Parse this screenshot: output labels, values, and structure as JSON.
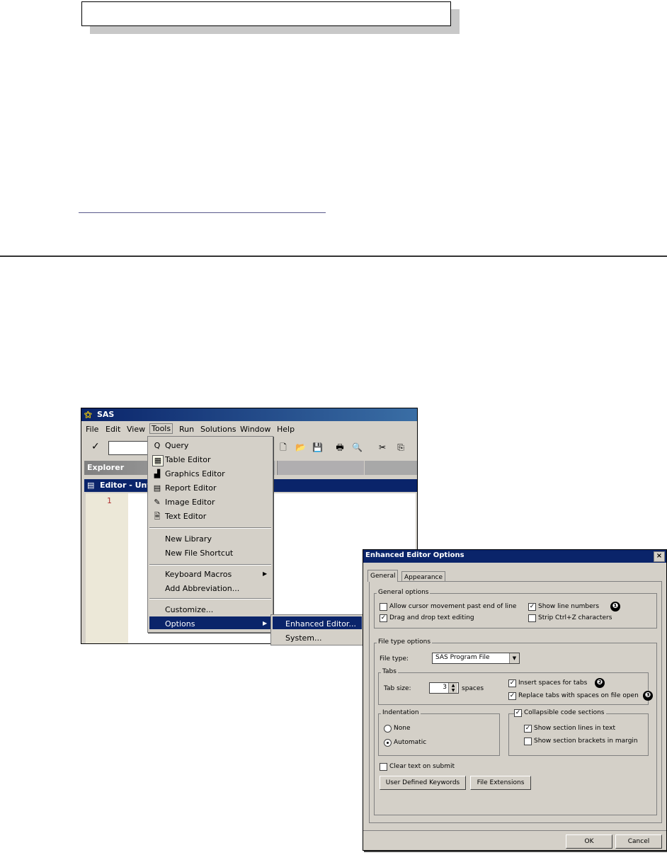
{
  "sas_window": {
    "title": "SAS",
    "menus": [
      "File",
      "Edit",
      "View",
      "Tools",
      "Run",
      "Solutions",
      "Window",
      "Help"
    ],
    "explorer_label": "Explorer",
    "editor_title": "Editor - Unti",
    "line_number": "1"
  },
  "tools_menu": {
    "items": [
      {
        "label": "Query",
        "icon": "query-icon"
      },
      {
        "label": "Table Editor",
        "icon": "table-editor-icon"
      },
      {
        "label": "Graphics Editor",
        "icon": "graphics-editor-icon"
      },
      {
        "label": "Report Editor",
        "icon": "report-editor-icon"
      },
      {
        "label": "Image Editor",
        "icon": "image-editor-icon"
      },
      {
        "label": "Text Editor",
        "icon": "text-editor-icon"
      },
      {
        "label": "New Library"
      },
      {
        "label": "New File Shortcut"
      },
      {
        "label": "Keyboard Macros"
      },
      {
        "label": "Add Abbreviation..."
      },
      {
        "label": "Customize..."
      },
      {
        "label": "Options"
      }
    ],
    "submenu": [
      "Enhanced Editor...",
      "System..."
    ]
  },
  "dialog": {
    "title": "Enhanced Editor Options",
    "close": "×",
    "tabs": [
      "General",
      "Appearance"
    ],
    "general_options": {
      "label": "General options",
      "allow_cursor": "Allow cursor movement past end of line",
      "drag_drop": "Drag and drop text editing",
      "show_line_numbers": "Show line numbers",
      "strip_ctrl_z": "Strip Ctrl+Z characters"
    },
    "file_type_options": {
      "label": "File type options",
      "file_type_label": "File type:",
      "file_type_value": "SAS Program File"
    },
    "tabs_group": {
      "label": "Tabs",
      "tab_size_label": "Tab size:",
      "tab_size_value": "3",
      "spaces_label": "spaces",
      "insert_spaces": "Insert spaces for tabs",
      "replace_tabs": "Replace tabs with spaces on file open"
    },
    "indentation": {
      "label": "Indentation",
      "none": "None",
      "automatic": "Automatic"
    },
    "collapsible": {
      "label": "Collapsible code sections",
      "section_lines": "Show section lines in text",
      "section_brackets": "Show section brackets in margin"
    },
    "clear_text": "Clear text on submit",
    "buttons": {
      "user_keywords": "User Defined Keywords",
      "file_extensions": "File Extensions",
      "ok": "OK",
      "cancel": "Cancel"
    },
    "callouts": [
      "❶",
      "❷",
      "❸"
    ]
  },
  "colors": {
    "title_bar": "#0a246a",
    "window_bg": "#d4d0c8"
  }
}
